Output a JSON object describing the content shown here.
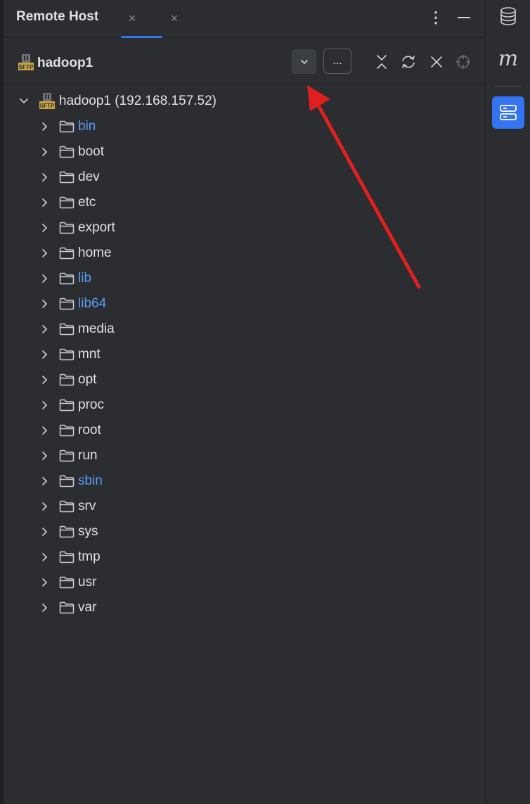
{
  "panel": {
    "title": "Remote Host",
    "tabs_close": [
      "×",
      "×"
    ],
    "more_label": "⋮"
  },
  "toolbar": {
    "host_name": "hadoop1",
    "dots_label": "...",
    "dropdown_icon": "chevron-down-icon",
    "actions": [
      "collapse-icon",
      "sync-icon",
      "close-icon",
      "target-icon"
    ]
  },
  "tree": {
    "root": "hadoop1 (192.168.157.52)",
    "children": [
      {
        "name": "bin",
        "link": true
      },
      {
        "name": "boot",
        "link": false
      },
      {
        "name": "dev",
        "link": false
      },
      {
        "name": "etc",
        "link": false
      },
      {
        "name": "export",
        "link": false
      },
      {
        "name": "home",
        "link": false
      },
      {
        "name": "lib",
        "link": true
      },
      {
        "name": "lib64",
        "link": true
      },
      {
        "name": "media",
        "link": false
      },
      {
        "name": "mnt",
        "link": false
      },
      {
        "name": "opt",
        "link": false
      },
      {
        "name": "proc",
        "link": false
      },
      {
        "name": "root",
        "link": false
      },
      {
        "name": "run",
        "link": false
      },
      {
        "name": "sbin",
        "link": true
      },
      {
        "name": "srv",
        "link": false
      },
      {
        "name": "sys",
        "link": false
      },
      {
        "name": "tmp",
        "link": false
      },
      {
        "name": "usr",
        "link": false
      },
      {
        "name": "var",
        "link": false
      }
    ]
  },
  "right_sidebar": {
    "items": [
      "database-icon",
      "maven-icon",
      "remote-host-icon"
    ],
    "maven_glyph": "m"
  },
  "colors": {
    "accent": "#3574f0",
    "link": "#589df6",
    "annotation_arrow": "#e02020",
    "sftp_icon": "#c9a33f"
  }
}
